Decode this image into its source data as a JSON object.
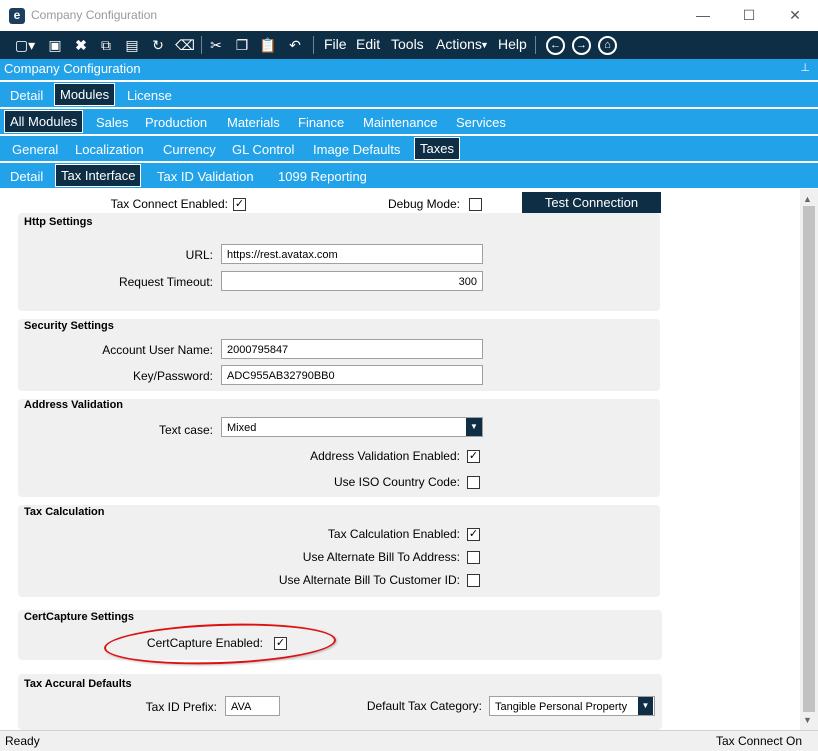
{
  "window": {
    "title": "Company Configuration",
    "logo_letter": "e"
  },
  "toolbar": {
    "menus": [
      "File",
      "Edit",
      "Tools",
      "Actions",
      "Help"
    ],
    "actions_caret": "▸"
  },
  "panel": {
    "title": "Company Configuration"
  },
  "tabs_l1": [
    "Detail",
    "Modules",
    "License"
  ],
  "tabs_l2": [
    "All Modules",
    "Sales",
    "Production",
    "Materials",
    "Finance",
    "Maintenance",
    "Services"
  ],
  "tabs_l3": [
    "General",
    "Localization",
    "Currency",
    "GL Control",
    "Image Defaults",
    "Taxes"
  ],
  "tabs_l4": [
    "Detail",
    "Tax Interface",
    "Tax ID Validation",
    "1099 Reporting"
  ],
  "top_fields": {
    "tax_connect_label": "Tax Connect Enabled:",
    "debug_label": "Debug Mode:",
    "test_button": "Test Connection"
  },
  "http": {
    "title": "Http Settings",
    "url_label": "URL:",
    "url_value": "https://rest.avatax.com",
    "timeout_label": "Request Timeout:",
    "timeout_value": "300"
  },
  "security": {
    "title": "Security Settings",
    "user_label": "Account User Name:",
    "user_value": "2000795847",
    "key_label": "Key/Password:",
    "key_value": "ADC955AB32790BB0"
  },
  "address": {
    "title": "Address Validation",
    "textcase_label": "Text case:",
    "textcase_value": "Mixed",
    "enabled_label": "Address Validation Enabled:",
    "iso_label": "Use ISO Country Code:"
  },
  "taxcalc": {
    "title": "Tax Calculation",
    "enabled_label": "Tax Calculation Enabled:",
    "alt_bill_label": "Use Alternate Bill To Address:",
    "alt_cust_label": "Use Alternate Bill To Customer ID:"
  },
  "certcapture": {
    "title": "CertCapture Settings",
    "enabled_label": "CertCapture Enabled:"
  },
  "accrual": {
    "title": "Tax Accural Defaults",
    "prefix_label": "Tax ID Prefix:",
    "prefix_value": "AVA",
    "category_label": "Default Tax Category:",
    "category_value": "Tangible Personal Property"
  },
  "status": {
    "left": "Ready",
    "right": "Tax Connect On"
  },
  "checks": {
    "tax_connect": true,
    "debug": false,
    "addr_enabled": true,
    "iso": false,
    "calc_enabled": true,
    "alt_bill": false,
    "alt_cust": false,
    "cert_enabled": true
  },
  "colors": {
    "toolbar": "#0e2e46",
    "tabbar": "#22a2e8",
    "group_bg": "#f0f0f0",
    "oval": "#d11111"
  }
}
